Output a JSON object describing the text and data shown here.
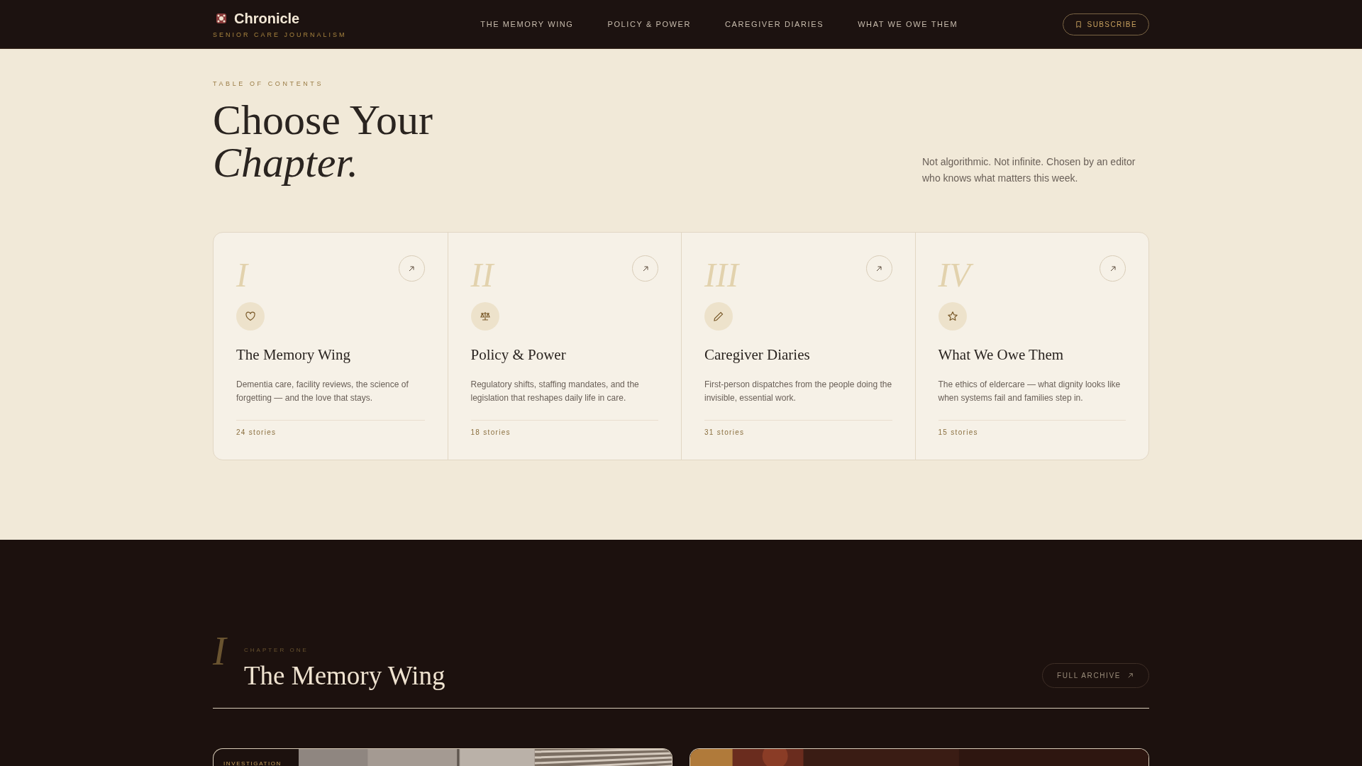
{
  "brand": {
    "name": "Chronicle",
    "tagline": "SENIOR CARE JOURNALISM"
  },
  "nav": [
    {
      "label": "THE MEMORY WING"
    },
    {
      "label": "POLICY & POWER"
    },
    {
      "label": "CAREGIVER DIARIES"
    },
    {
      "label": "WHAT WE OWE THEM"
    }
  ],
  "subscribe": "SUBSCRIBE",
  "toc": {
    "eyebrow": "TABLE OF CONTENTS",
    "title_line1": "Choose Your",
    "title_line2": "Chapter.",
    "intro": "Not algorithmic. Not infinite. Chosen by an editor who knows what matters this week."
  },
  "chapters": [
    {
      "numeral": "I",
      "title": "The Memory Wing",
      "description": "Dementia care, facility reviews, the science of forgetting — and the love that stays.",
      "count": "24 stories"
    },
    {
      "numeral": "II",
      "title": "Policy & Power",
      "description": "Regulatory shifts, staffing mandates, and the legislation that reshapes daily life in care.",
      "count": "18 stories"
    },
    {
      "numeral": "III",
      "title": "Caregiver Diaries",
      "description": "First-person dispatches from the people doing the invisible, essential work.",
      "count": "31 stories"
    },
    {
      "numeral": "IV",
      "title": "What We Owe Them",
      "description": "The ethics of eldercare — what dignity looks like when systems fail and families step in.",
      "count": "15 stories"
    }
  ],
  "section": {
    "numeral": "I",
    "eyebrow": "CHAPTER ONE",
    "title": "The Memory Wing",
    "archive": "FULL ARCHIVE"
  },
  "stories": [
    {
      "kind": "picture",
      "tag": "INVESTIGATION"
    },
    {
      "kind": "picture"
    }
  ]
}
